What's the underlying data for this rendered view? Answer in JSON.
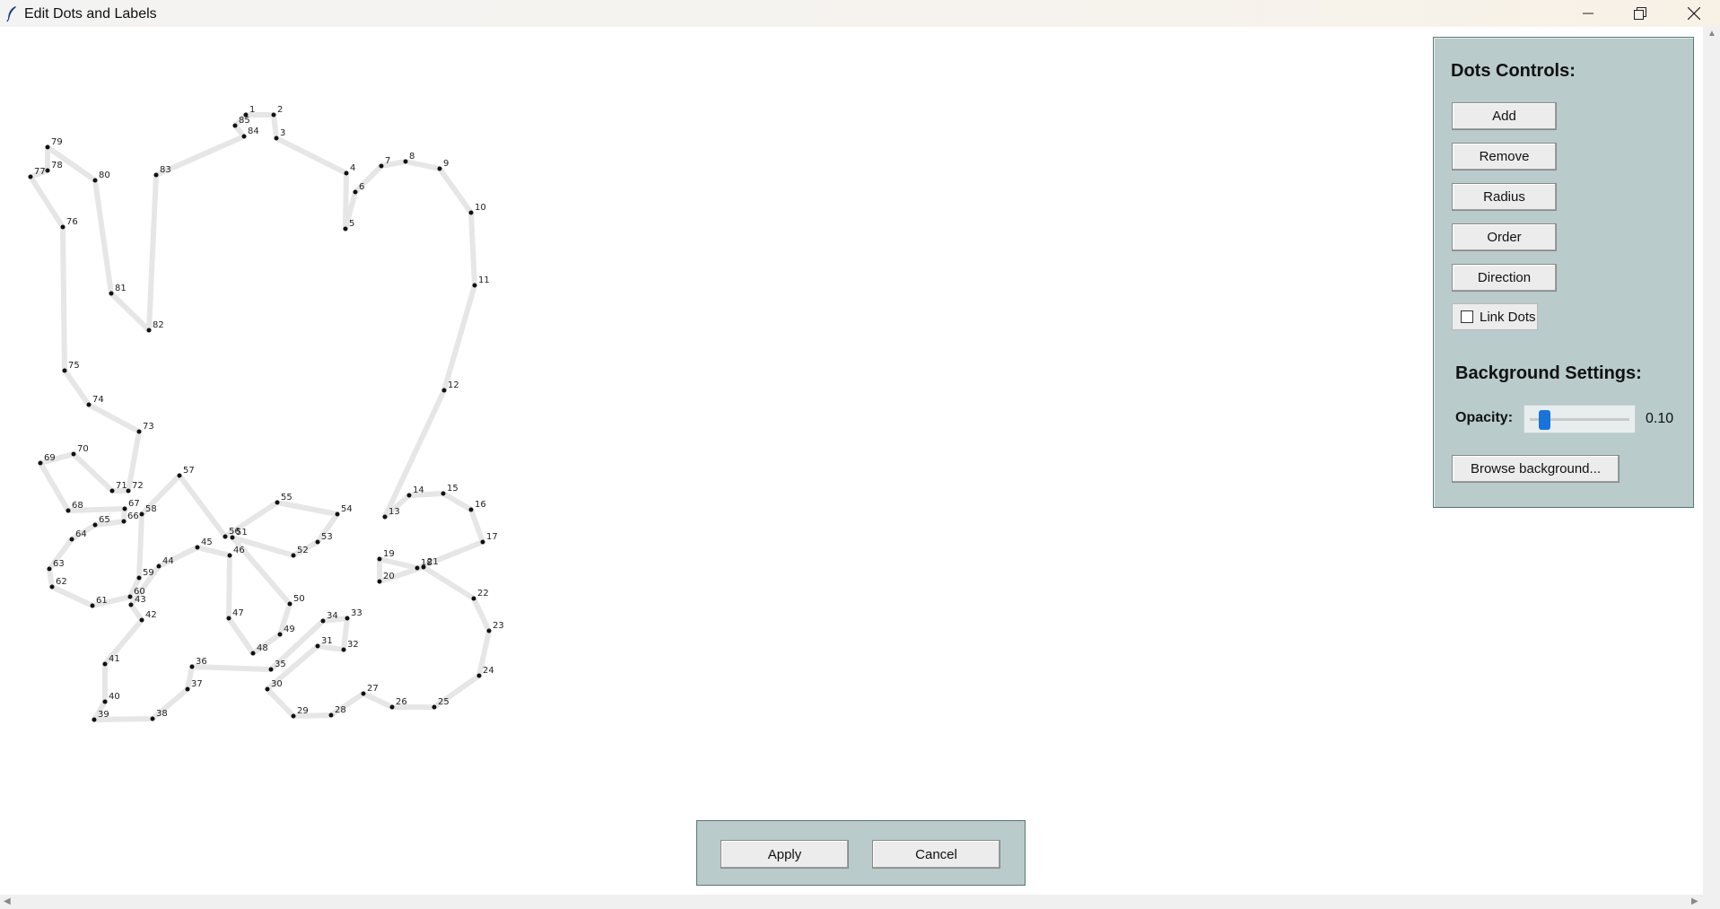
{
  "window": {
    "title": "Edit Dots and Labels",
    "controls": {
      "minimize_icon": "minimize-icon",
      "restore_icon": "restore-icon",
      "close_icon": "close-icon"
    }
  },
  "dots_panel": {
    "title": "Dots Controls:",
    "buttons": {
      "add": "Add",
      "remove": "Remove",
      "radius": "Radius",
      "order": "Order",
      "direction": "Direction"
    },
    "link_dots": {
      "label": "Link Dots",
      "checked": false
    }
  },
  "background_panel": {
    "title": "Background Settings:",
    "opacity_label": "Opacity:",
    "opacity_value": "0.10",
    "opacity_fraction": 0.1,
    "browse_label": "Browse background..."
  },
  "actions": {
    "apply": "Apply",
    "cancel": "Cancel"
  },
  "dot_labels": [
    "1",
    "2",
    "3",
    "4",
    "5",
    "6",
    "7",
    "8",
    "9",
    "10",
    "11",
    "12",
    "13",
    "14",
    "15",
    "16",
    "17",
    "18",
    "19",
    "20",
    "21",
    "22",
    "23",
    "24",
    "25",
    "26",
    "27",
    "28",
    "29",
    "30",
    "31",
    "32",
    "33",
    "34",
    "35",
    "36",
    "37",
    "38",
    "39",
    "40",
    "41",
    "42",
    "43",
    "44",
    "45",
    "46",
    "47",
    "48",
    "49",
    "50",
    "51",
    "52",
    "53",
    "54",
    "55",
    "56",
    "57",
    "58",
    "59",
    "60",
    "61",
    "62",
    "63",
    "64",
    "65",
    "66",
    "67",
    "68",
    "69",
    "70",
    "71",
    "72",
    "73",
    "74",
    "75",
    "76",
    "77",
    "78",
    "79",
    "80",
    "81",
    "82",
    "83",
    "84",
    "85"
  ],
  "colors": {
    "panel_bg": "#b9cbcb",
    "outline": "#e6e6e6",
    "slider_thumb": "#1a73d8"
  }
}
